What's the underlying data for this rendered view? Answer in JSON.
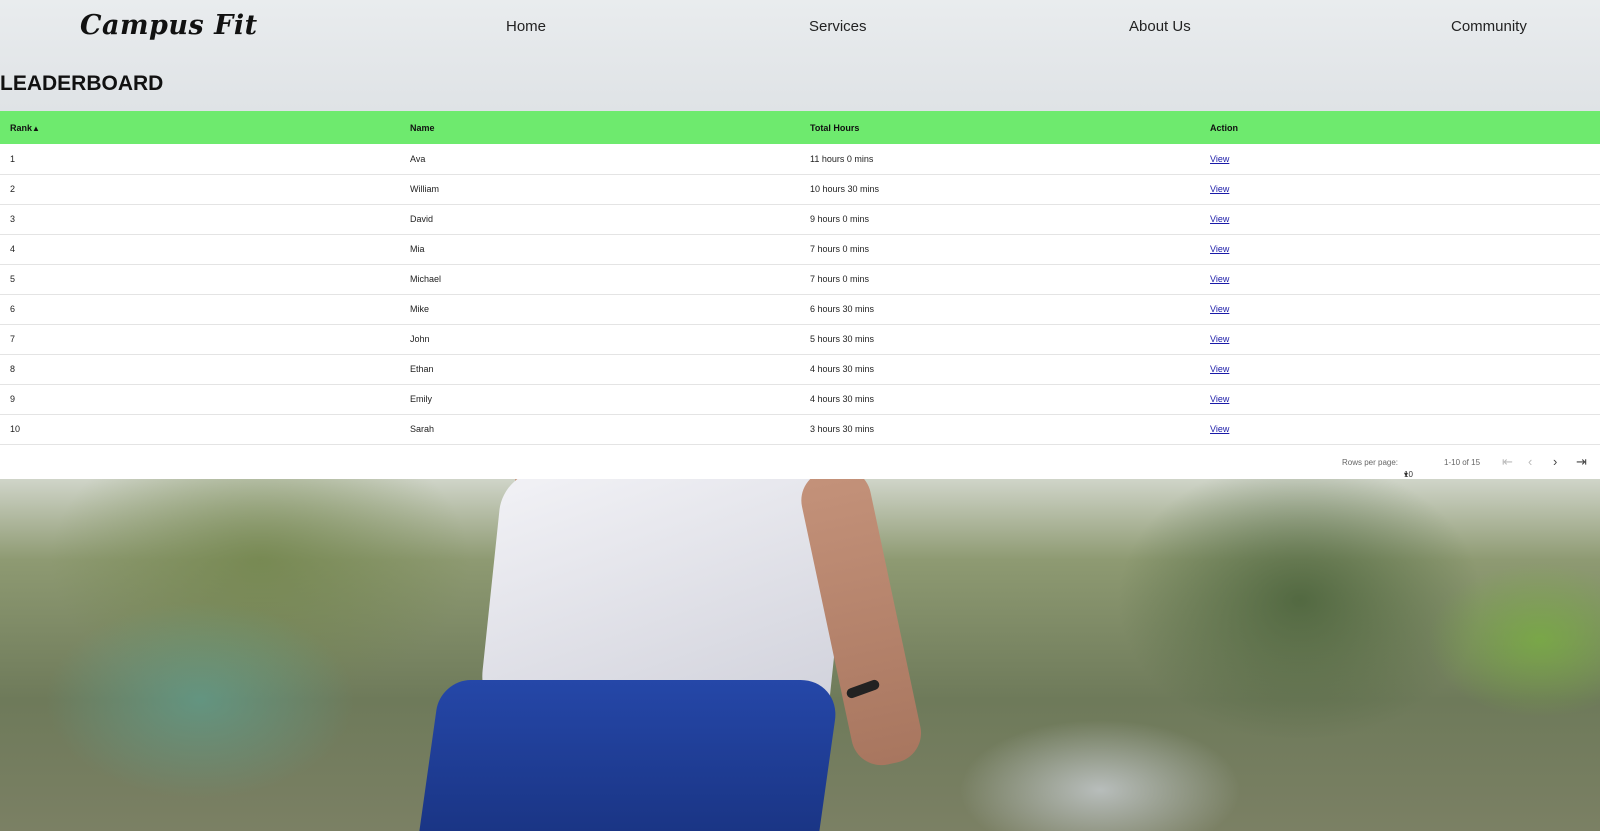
{
  "brand": "Campus Fit",
  "nav": [
    {
      "label": "Home"
    },
    {
      "label": "Services"
    },
    {
      "label": "About Us"
    },
    {
      "label": "Community"
    }
  ],
  "page_title": "LEADERBOARD",
  "table": {
    "headers": {
      "rank": "Rank",
      "name": "Name",
      "hours": "Total Hours",
      "action": "Action"
    },
    "sort_indicator": "▲",
    "header_color": "#6eea6e",
    "rows": [
      {
        "rank": "1",
        "name": "Ava",
        "hours": "11 hours 0 mins",
        "action": "View"
      },
      {
        "rank": "2",
        "name": "William",
        "hours": "10 hours 30 mins",
        "action": "View"
      },
      {
        "rank": "3",
        "name": "David",
        "hours": "9 hours 0 mins",
        "action": "View"
      },
      {
        "rank": "4",
        "name": "Mia",
        "hours": "7 hours 0 mins",
        "action": "View"
      },
      {
        "rank": "5",
        "name": "Michael",
        "hours": "7 hours 0 mins",
        "action": "View"
      },
      {
        "rank": "6",
        "name": "Mike",
        "hours": "6 hours 30 mins",
        "action": "View"
      },
      {
        "rank": "7",
        "name": "John",
        "hours": "5 hours 30 mins",
        "action": "View"
      },
      {
        "rank": "8",
        "name": "Ethan",
        "hours": "4 hours 30 mins",
        "action": "View"
      },
      {
        "rank": "9",
        "name": "Emily",
        "hours": "4 hours 30 mins",
        "action": "View"
      },
      {
        "rank": "10",
        "name": "Sarah",
        "hours": "3 hours 30 mins",
        "action": "View"
      }
    ]
  },
  "pagination": {
    "rows_per_page_label": "Rows per page:",
    "rows_per_page_value": "10",
    "range": "1-10 of 15",
    "icons": {
      "first": "first-page-icon",
      "prev": "prev-page-icon",
      "next": "next-page-icon",
      "last": "last-page-icon"
    }
  }
}
